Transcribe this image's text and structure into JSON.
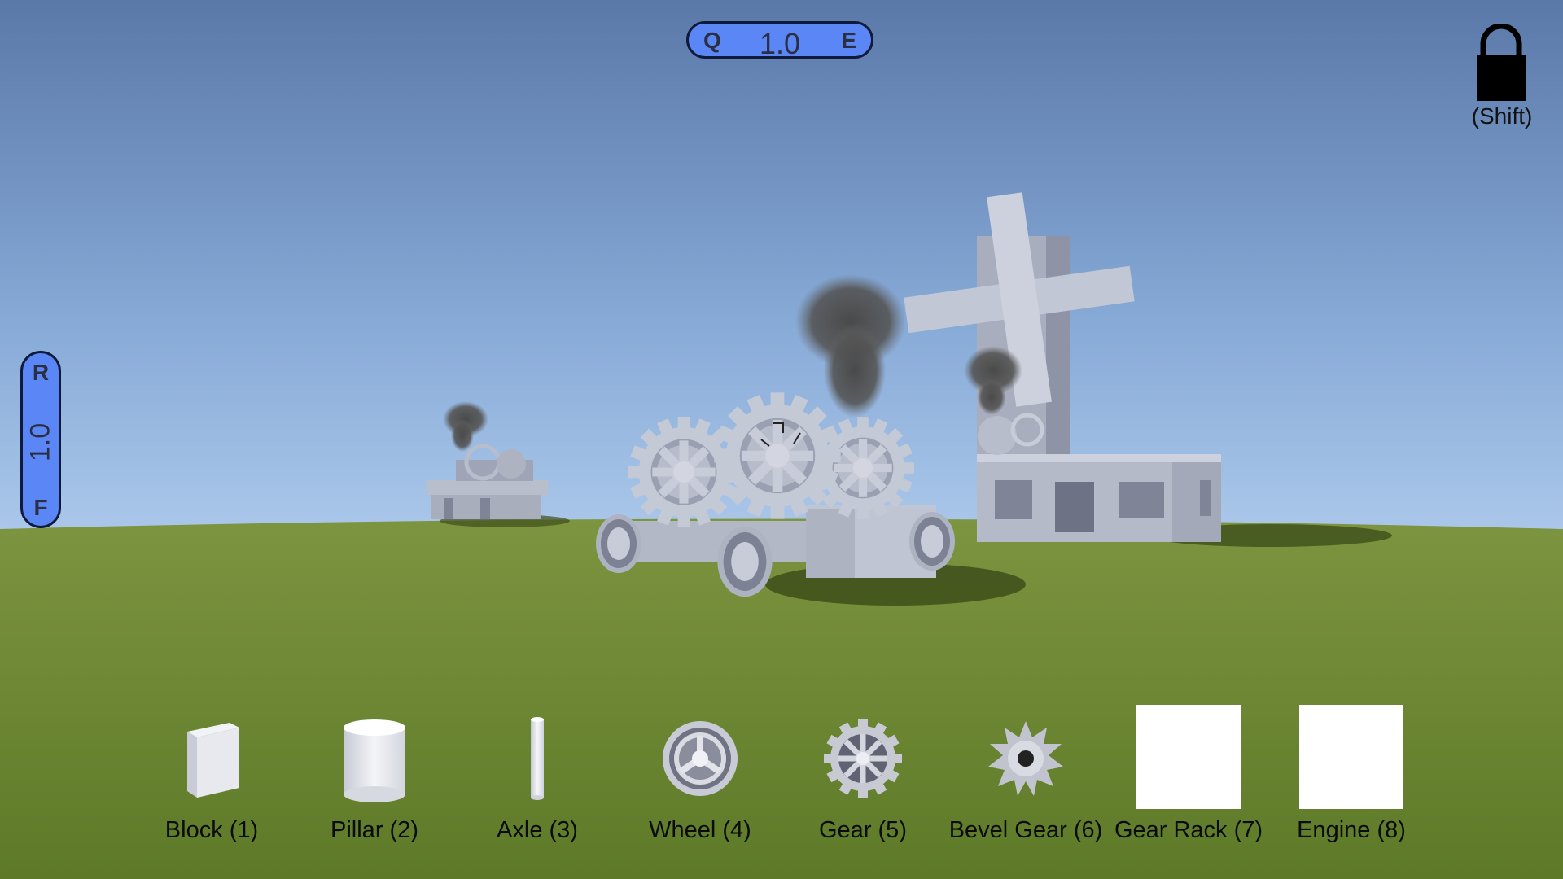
{
  "hud": {
    "scale_q_key": "Q",
    "scale_e_key": "E",
    "scale_value": "1.0",
    "rotate_r_key": "R",
    "rotate_f_key": "F",
    "rotate_value": "1.0",
    "lock_label": "(Shift)",
    "lock_icon": "padlock-icon",
    "accent_color": "#5b86f5"
  },
  "toolbar": {
    "items": [
      {
        "label": "Block (1)",
        "icon": "block-icon"
      },
      {
        "label": "Pillar (2)",
        "icon": "pillar-icon"
      },
      {
        "label": "Axle (3)",
        "icon": "axle-icon"
      },
      {
        "label": "Wheel (4)",
        "icon": "wheel-icon"
      },
      {
        "label": "Gear (5)",
        "icon": "gear-icon"
      },
      {
        "label": "Bevel Gear (6)",
        "icon": "bevel-gear-icon"
      },
      {
        "label": "Gear Rack (7)",
        "icon": "gear-rack-icon"
      },
      {
        "label": "Engine (8)",
        "icon": "engine-icon"
      }
    ]
  },
  "scene": {
    "sky_top": "#5a78a8",
    "sky_horizon": "#a9c7ea",
    "ground": "#6d8a32"
  }
}
